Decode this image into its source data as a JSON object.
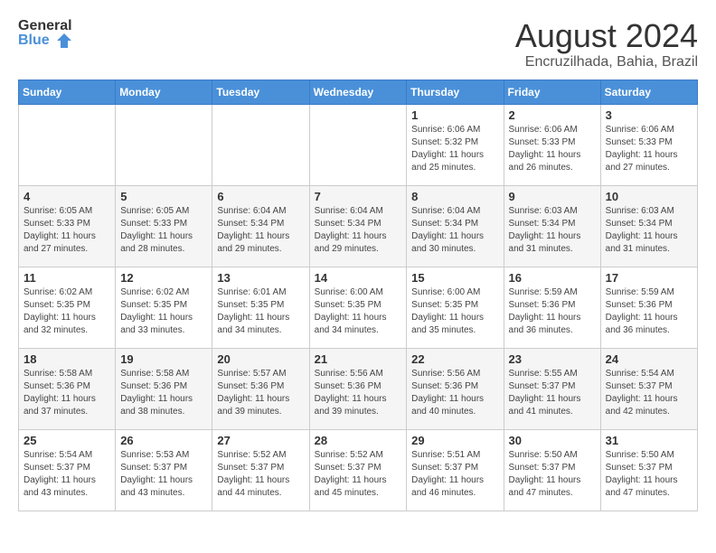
{
  "logo": {
    "line1": "General",
    "line2": "Blue"
  },
  "title": "August 2024",
  "location": "Encruzilhada, Bahia, Brazil",
  "days_of_week": [
    "Sunday",
    "Monday",
    "Tuesday",
    "Wednesday",
    "Thursday",
    "Friday",
    "Saturday"
  ],
  "weeks": [
    [
      {
        "day": "",
        "info": ""
      },
      {
        "day": "",
        "info": ""
      },
      {
        "day": "",
        "info": ""
      },
      {
        "day": "",
        "info": ""
      },
      {
        "day": "1",
        "info": "Sunrise: 6:06 AM\nSunset: 5:32 PM\nDaylight: 11 hours and 25 minutes."
      },
      {
        "day": "2",
        "info": "Sunrise: 6:06 AM\nSunset: 5:33 PM\nDaylight: 11 hours and 26 minutes."
      },
      {
        "day": "3",
        "info": "Sunrise: 6:06 AM\nSunset: 5:33 PM\nDaylight: 11 hours and 27 minutes."
      }
    ],
    [
      {
        "day": "4",
        "info": "Sunrise: 6:05 AM\nSunset: 5:33 PM\nDaylight: 11 hours and 27 minutes."
      },
      {
        "day": "5",
        "info": "Sunrise: 6:05 AM\nSunset: 5:33 PM\nDaylight: 11 hours and 28 minutes."
      },
      {
        "day": "6",
        "info": "Sunrise: 6:04 AM\nSunset: 5:34 PM\nDaylight: 11 hours and 29 minutes."
      },
      {
        "day": "7",
        "info": "Sunrise: 6:04 AM\nSunset: 5:34 PM\nDaylight: 11 hours and 29 minutes."
      },
      {
        "day": "8",
        "info": "Sunrise: 6:04 AM\nSunset: 5:34 PM\nDaylight: 11 hours and 30 minutes."
      },
      {
        "day": "9",
        "info": "Sunrise: 6:03 AM\nSunset: 5:34 PM\nDaylight: 11 hours and 31 minutes."
      },
      {
        "day": "10",
        "info": "Sunrise: 6:03 AM\nSunset: 5:34 PM\nDaylight: 11 hours and 31 minutes."
      }
    ],
    [
      {
        "day": "11",
        "info": "Sunrise: 6:02 AM\nSunset: 5:35 PM\nDaylight: 11 hours and 32 minutes."
      },
      {
        "day": "12",
        "info": "Sunrise: 6:02 AM\nSunset: 5:35 PM\nDaylight: 11 hours and 33 minutes."
      },
      {
        "day": "13",
        "info": "Sunrise: 6:01 AM\nSunset: 5:35 PM\nDaylight: 11 hours and 34 minutes."
      },
      {
        "day": "14",
        "info": "Sunrise: 6:00 AM\nSunset: 5:35 PM\nDaylight: 11 hours and 34 minutes."
      },
      {
        "day": "15",
        "info": "Sunrise: 6:00 AM\nSunset: 5:35 PM\nDaylight: 11 hours and 35 minutes."
      },
      {
        "day": "16",
        "info": "Sunrise: 5:59 AM\nSunset: 5:36 PM\nDaylight: 11 hours and 36 minutes."
      },
      {
        "day": "17",
        "info": "Sunrise: 5:59 AM\nSunset: 5:36 PM\nDaylight: 11 hours and 36 minutes."
      }
    ],
    [
      {
        "day": "18",
        "info": "Sunrise: 5:58 AM\nSunset: 5:36 PM\nDaylight: 11 hours and 37 minutes."
      },
      {
        "day": "19",
        "info": "Sunrise: 5:58 AM\nSunset: 5:36 PM\nDaylight: 11 hours and 38 minutes."
      },
      {
        "day": "20",
        "info": "Sunrise: 5:57 AM\nSunset: 5:36 PM\nDaylight: 11 hours and 39 minutes."
      },
      {
        "day": "21",
        "info": "Sunrise: 5:56 AM\nSunset: 5:36 PM\nDaylight: 11 hours and 39 minutes."
      },
      {
        "day": "22",
        "info": "Sunrise: 5:56 AM\nSunset: 5:36 PM\nDaylight: 11 hours and 40 minutes."
      },
      {
        "day": "23",
        "info": "Sunrise: 5:55 AM\nSunset: 5:37 PM\nDaylight: 11 hours and 41 minutes."
      },
      {
        "day": "24",
        "info": "Sunrise: 5:54 AM\nSunset: 5:37 PM\nDaylight: 11 hours and 42 minutes."
      }
    ],
    [
      {
        "day": "25",
        "info": "Sunrise: 5:54 AM\nSunset: 5:37 PM\nDaylight: 11 hours and 43 minutes."
      },
      {
        "day": "26",
        "info": "Sunrise: 5:53 AM\nSunset: 5:37 PM\nDaylight: 11 hours and 43 minutes."
      },
      {
        "day": "27",
        "info": "Sunrise: 5:52 AM\nSunset: 5:37 PM\nDaylight: 11 hours and 44 minutes."
      },
      {
        "day": "28",
        "info": "Sunrise: 5:52 AM\nSunset: 5:37 PM\nDaylight: 11 hours and 45 minutes."
      },
      {
        "day": "29",
        "info": "Sunrise: 5:51 AM\nSunset: 5:37 PM\nDaylight: 11 hours and 46 minutes."
      },
      {
        "day": "30",
        "info": "Sunrise: 5:50 AM\nSunset: 5:37 PM\nDaylight: 11 hours and 47 minutes."
      },
      {
        "day": "31",
        "info": "Sunrise: 5:50 AM\nSunset: 5:37 PM\nDaylight: 11 hours and 47 minutes."
      }
    ]
  ]
}
